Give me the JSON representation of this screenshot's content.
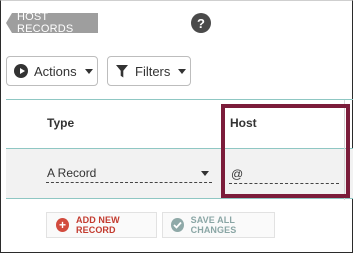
{
  "header": {
    "title": "HOST RECORDS",
    "help_label": "?"
  },
  "toolbar": {
    "actions_label": "Actions",
    "filters_label": "Filters"
  },
  "table": {
    "columns": [
      "Type",
      "Host"
    ],
    "rows": [
      {
        "type": "A Record",
        "host": "@"
      }
    ]
  },
  "footer": {
    "add_label": "ADD NEW RECORD",
    "save_label": "SAVE ALL CHANGES"
  },
  "colors": {
    "teal_divider": "#8fc7c3",
    "highlight_border": "#7b1c3a",
    "add_red": "#d24b3e",
    "save_muted": "#8fa9a8"
  }
}
